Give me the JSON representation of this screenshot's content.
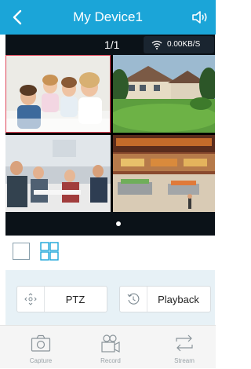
{
  "header": {
    "title": "My Device1"
  },
  "status": {
    "page_indicator": "1/1",
    "speed": "0.00KB/S"
  },
  "controls": {
    "ptz_label": "PTZ",
    "playback_label": "Playback"
  },
  "tabs": [
    {
      "label": "Capture",
      "icon": "camera-icon"
    },
    {
      "label": "Record",
      "icon": "video-camera-icon"
    },
    {
      "label": "Stream",
      "icon": "swap-arrows-icon"
    }
  ],
  "colors": {
    "accent": "#1ba5d8",
    "selected_border": "#e0465a",
    "dark_bar": "#0b1218"
  }
}
